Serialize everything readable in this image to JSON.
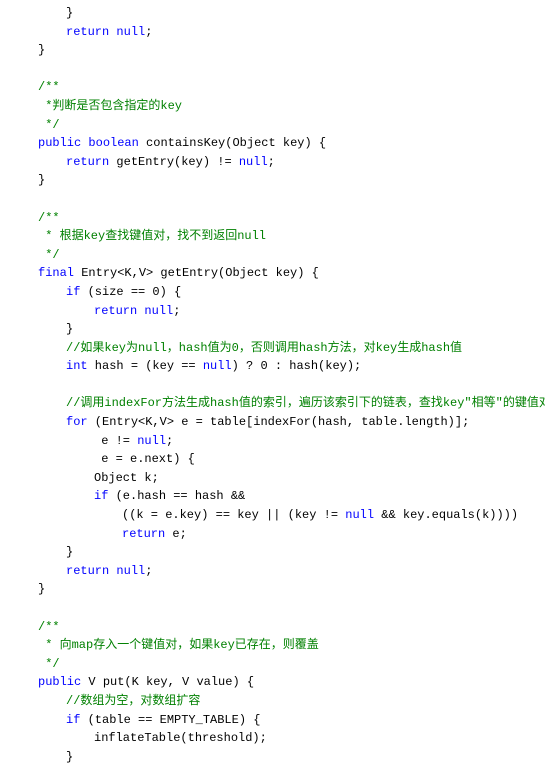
{
  "lines": [
    {
      "indent": 2,
      "segments": [
        {
          "t": "}",
          "c": ""
        }
      ]
    },
    {
      "indent": 2,
      "segments": [
        {
          "t": "return",
          "c": "kw"
        },
        {
          "t": " ",
          "c": ""
        },
        {
          "t": "null",
          "c": "kw"
        },
        {
          "t": ";",
          "c": ""
        }
      ]
    },
    {
      "indent": 1,
      "segments": [
        {
          "t": "}",
          "c": ""
        }
      ]
    },
    {
      "indent": 0,
      "segments": [
        {
          "t": " ",
          "c": ""
        }
      ]
    },
    {
      "indent": 1,
      "segments": [
        {
          "t": "/**",
          "c": "cm"
        }
      ]
    },
    {
      "indent": 1,
      "segments": [
        {
          "t": " *判断是否包含指定的key",
          "c": "cm"
        }
      ]
    },
    {
      "indent": 1,
      "segments": [
        {
          "t": " */",
          "c": "cm"
        }
      ]
    },
    {
      "indent": 1,
      "segments": [
        {
          "t": "public",
          "c": "kw"
        },
        {
          "t": " ",
          "c": ""
        },
        {
          "t": "boolean",
          "c": "kw"
        },
        {
          "t": " containsKey(Object key) {",
          "c": ""
        }
      ]
    },
    {
      "indent": 2,
      "segments": [
        {
          "t": "return",
          "c": "kw"
        },
        {
          "t": " getEntry(key) != ",
          "c": ""
        },
        {
          "t": "null",
          "c": "kw"
        },
        {
          "t": ";",
          "c": ""
        }
      ]
    },
    {
      "indent": 1,
      "segments": [
        {
          "t": "}",
          "c": ""
        }
      ]
    },
    {
      "indent": 0,
      "segments": [
        {
          "t": " ",
          "c": ""
        }
      ]
    },
    {
      "indent": 1,
      "segments": [
        {
          "t": "/**",
          "c": "cm"
        }
      ]
    },
    {
      "indent": 1,
      "segments": [
        {
          "t": " * 根据key查找键值对，找不到返回null",
          "c": "cm"
        }
      ]
    },
    {
      "indent": 1,
      "segments": [
        {
          "t": " */",
          "c": "cm"
        }
      ]
    },
    {
      "indent": 1,
      "segments": [
        {
          "t": "final",
          "c": "kw"
        },
        {
          "t": " Entry<K,V> getEntry(Object key) {",
          "c": ""
        }
      ]
    },
    {
      "indent": 2,
      "segments": [
        {
          "t": "if",
          "c": "kw"
        },
        {
          "t": " (size == 0) {",
          "c": ""
        }
      ]
    },
    {
      "indent": 3,
      "segments": [
        {
          "t": "return",
          "c": "kw"
        },
        {
          "t": " ",
          "c": ""
        },
        {
          "t": "null",
          "c": "kw"
        },
        {
          "t": ";",
          "c": ""
        }
      ]
    },
    {
      "indent": 2,
      "segments": [
        {
          "t": "}",
          "c": ""
        }
      ]
    },
    {
      "indent": 2,
      "segments": [
        {
          "t": "//如果key为null，hash值为0，否则调用hash方法，对key生成hash值",
          "c": "cm"
        }
      ]
    },
    {
      "indent": 2,
      "segments": [
        {
          "t": "int",
          "c": "kw"
        },
        {
          "t": " hash = (key == ",
          "c": ""
        },
        {
          "t": "null",
          "c": "kw"
        },
        {
          "t": ") ? 0 : hash(key);",
          "c": ""
        }
      ]
    },
    {
      "indent": 0,
      "segments": [
        {
          "t": " ",
          "c": ""
        }
      ]
    },
    {
      "indent": 2,
      "segments": [
        {
          "t": "//调用indexFor方法生成hash值的索引，遍历该索引下的链表，查找key\"相等\"的键值对",
          "c": "cm"
        }
      ]
    },
    {
      "indent": 2,
      "segments": [
        {
          "t": "for",
          "c": "kw"
        },
        {
          "t": " (Entry<K,V> e = table[indexFor(hash, table.length)];",
          "c": ""
        }
      ]
    },
    {
      "indent": 3,
      "segments": [
        {
          "t": " e != ",
          "c": ""
        },
        {
          "t": "null",
          "c": "kw"
        },
        {
          "t": ";",
          "c": ""
        }
      ]
    },
    {
      "indent": 3,
      "segments": [
        {
          "t": " e = e.next) {",
          "c": ""
        }
      ]
    },
    {
      "indent": 3,
      "segments": [
        {
          "t": "Object k;",
          "c": ""
        }
      ]
    },
    {
      "indent": 3,
      "segments": [
        {
          "t": "if",
          "c": "kw"
        },
        {
          "t": " (e.hash == hash &&",
          "c": ""
        }
      ]
    },
    {
      "indent": 4,
      "segments": [
        {
          "t": "((k = e.key) == key || (key != ",
          "c": ""
        },
        {
          "t": "null",
          "c": "kw"
        },
        {
          "t": " && key.equals(k))))",
          "c": ""
        }
      ]
    },
    {
      "indent": 4,
      "segments": [
        {
          "t": "return",
          "c": "kw"
        },
        {
          "t": " e;",
          "c": ""
        }
      ]
    },
    {
      "indent": 2,
      "segments": [
        {
          "t": "}",
          "c": ""
        }
      ]
    },
    {
      "indent": 2,
      "segments": [
        {
          "t": "return",
          "c": "kw"
        },
        {
          "t": " ",
          "c": ""
        },
        {
          "t": "null",
          "c": "kw"
        },
        {
          "t": ";",
          "c": ""
        }
      ]
    },
    {
      "indent": 1,
      "segments": [
        {
          "t": "}",
          "c": ""
        }
      ]
    },
    {
      "indent": 0,
      "segments": [
        {
          "t": " ",
          "c": ""
        }
      ]
    },
    {
      "indent": 1,
      "segments": [
        {
          "t": "/**",
          "c": "cm"
        }
      ]
    },
    {
      "indent": 1,
      "segments": [
        {
          "t": " * 向map存入一个键值对，如果key已存在，则覆盖",
          "c": "cm"
        }
      ]
    },
    {
      "indent": 1,
      "segments": [
        {
          "t": " */",
          "c": "cm"
        }
      ]
    },
    {
      "indent": 1,
      "segments": [
        {
          "t": "public",
          "c": "kw"
        },
        {
          "t": " V put(K key, V value) {",
          "c": ""
        }
      ]
    },
    {
      "indent": 2,
      "segments": [
        {
          "t": "//数组为空，对数组扩容",
          "c": "cm"
        }
      ]
    },
    {
      "indent": 2,
      "segments": [
        {
          "t": "if",
          "c": "kw"
        },
        {
          "t": " (table == EMPTY_TABLE) {",
          "c": ""
        }
      ]
    },
    {
      "indent": 3,
      "segments": [
        {
          "t": "inflateTable(threshold);",
          "c": ""
        }
      ]
    },
    {
      "indent": 2,
      "segments": [
        {
          "t": "}",
          "c": ""
        }
      ]
    }
  ]
}
